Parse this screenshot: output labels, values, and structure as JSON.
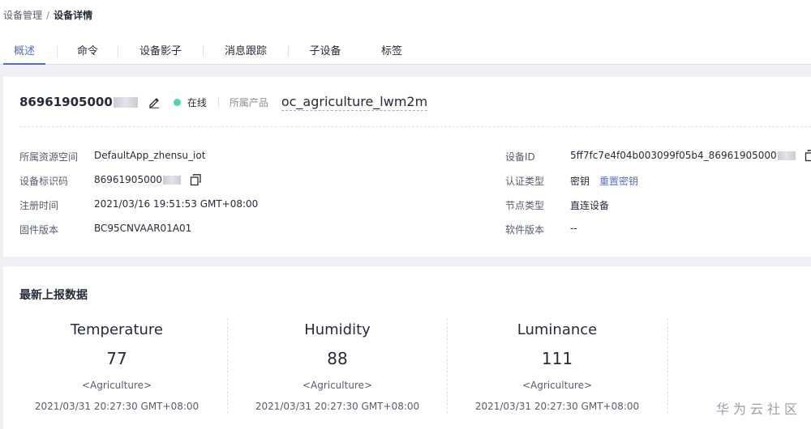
{
  "breadcrumb": {
    "parent": "设备管理",
    "separator": "/",
    "current": "设备详情"
  },
  "tabs": [
    {
      "label": "概述",
      "active": true
    },
    {
      "label": "命令",
      "active": false
    },
    {
      "label": "设备影子",
      "active": false
    },
    {
      "label": "消息跟踪",
      "active": false
    },
    {
      "label": "子设备",
      "active": false
    },
    {
      "label": "标签",
      "active": false
    }
  ],
  "device": {
    "name": "86961905000",
    "status": "在线",
    "product_label": "所属产品",
    "product": "oc_agriculture_lwm2m"
  },
  "info": {
    "resource_space": {
      "label": "所属资源空间",
      "value": "DefaultApp_zhensu_iot"
    },
    "node_identifier": {
      "label": "设备标识码",
      "value": "86961905000"
    },
    "registered": {
      "label": "注册时间",
      "value": "2021/03/16 19:51:53 GMT+08:00"
    },
    "firmware": {
      "label": "固件版本",
      "value": "BC95CNVAAR01A01"
    },
    "device_id": {
      "label": "设备ID",
      "value": "5ff7fc7e4f04b003099f05b4_86961905000"
    },
    "auth_type": {
      "label": "认证类型",
      "value": "密钥",
      "action": "重置密钥"
    },
    "node_type": {
      "label": "节点类型",
      "value": "直连设备"
    },
    "software": {
      "label": "软件版本",
      "value": "--"
    }
  },
  "latest": {
    "title": "最新上报数据",
    "metrics": [
      {
        "name": "Temperature",
        "value": "77",
        "service": "<Agriculture>",
        "time": "2021/03/31 20:27:30 GMT+08:00"
      },
      {
        "name": "Humidity",
        "value": "88",
        "service": "<Agriculture>",
        "time": "2021/03/31 20:27:30 GMT+08:00"
      },
      {
        "name": "Luminance",
        "value": "111",
        "service": "<Agriculture>",
        "time": "2021/03/31 20:27:30 GMT+08:00"
      }
    ]
  },
  "watermark": "华为云社区",
  "colors": {
    "accent": "#526ecc",
    "online": "#50d4ab",
    "background": "#eef0f5"
  }
}
